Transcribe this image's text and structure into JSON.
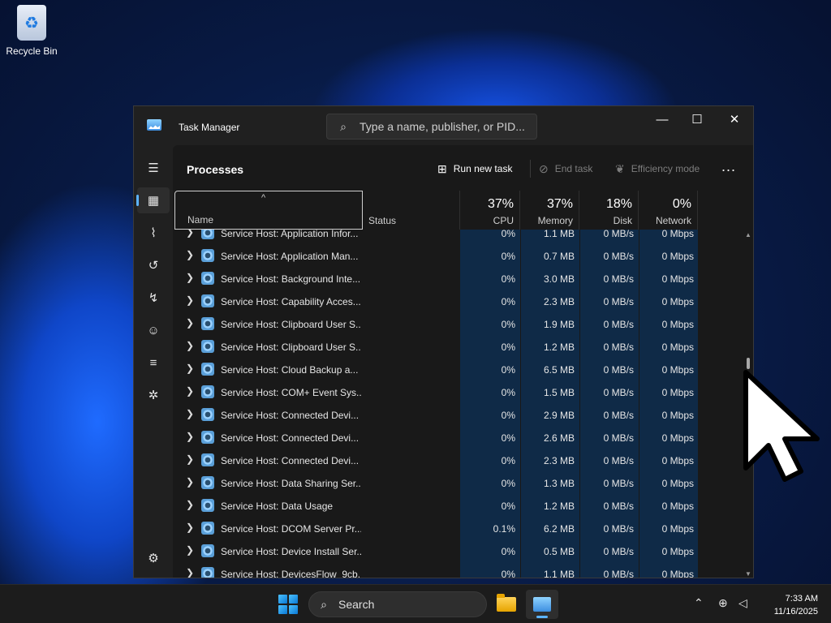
{
  "desktop": {
    "recycle_bin_label": "Recycle Bin"
  },
  "window": {
    "title": "Task Manager",
    "search_placeholder": "Type a name, publisher, or PID...",
    "controls": {
      "minimize": "—",
      "maximize": "☐",
      "close": "✕"
    }
  },
  "nav": {
    "items": [
      {
        "name": "hamburger-icon"
      },
      {
        "name": "processes-icon",
        "active": true
      },
      {
        "name": "performance-icon"
      },
      {
        "name": "app-history-icon"
      },
      {
        "name": "startup-apps-icon"
      },
      {
        "name": "users-icon"
      },
      {
        "name": "details-icon"
      },
      {
        "name": "services-icon"
      },
      {
        "name": "settings-icon"
      }
    ]
  },
  "toolbar": {
    "page_title": "Processes",
    "run_new_task": "Run new task",
    "end_task": "End task",
    "efficiency_mode": "Efficiency mode",
    "more": "..."
  },
  "table": {
    "columns": {
      "name": "Name",
      "status": "Status",
      "cpu": {
        "label": "CPU",
        "pct": "37%"
      },
      "memory": {
        "label": "Memory",
        "pct": "37%"
      },
      "disk": {
        "label": "Disk",
        "pct": "18%"
      },
      "network": {
        "label": "Network",
        "pct": "0%"
      }
    },
    "sort_caret": "^",
    "rows": [
      {
        "name": "Service Host: Application Infor...",
        "cpu": "0%",
        "memory": "1.1 MB",
        "disk": "0 MB/s",
        "network": "0 Mbps"
      },
      {
        "name": "Service Host: Application Man...",
        "cpu": "0%",
        "memory": "0.7 MB",
        "disk": "0 MB/s",
        "network": "0 Mbps"
      },
      {
        "name": "Service Host: Background Inte...",
        "cpu": "0%",
        "memory": "3.0 MB",
        "disk": "0 MB/s",
        "network": "0 Mbps"
      },
      {
        "name": "Service Host: Capability Acces...",
        "cpu": "0%",
        "memory": "2.3 MB",
        "disk": "0 MB/s",
        "network": "0 Mbps"
      },
      {
        "name": "Service Host: Clipboard User S...",
        "cpu": "0%",
        "memory": "1.9 MB",
        "disk": "0 MB/s",
        "network": "0 Mbps"
      },
      {
        "name": "Service Host: Clipboard User S...",
        "cpu": "0%",
        "memory": "1.2 MB",
        "disk": "0 MB/s",
        "network": "0 Mbps"
      },
      {
        "name": "Service Host: Cloud Backup a...",
        "cpu": "0%",
        "memory": "6.5 MB",
        "disk": "0 MB/s",
        "network": "0 Mbps"
      },
      {
        "name": "Service Host: COM+ Event Sys...",
        "cpu": "0%",
        "memory": "1.5 MB",
        "disk": "0 MB/s",
        "network": "0 Mbps"
      },
      {
        "name": "Service Host: Connected Devi...",
        "cpu": "0%",
        "memory": "2.9 MB",
        "disk": "0 MB/s",
        "network": "0 Mbps"
      },
      {
        "name": "Service Host: Connected Devi...",
        "cpu": "0%",
        "memory": "2.6 MB",
        "disk": "0 MB/s",
        "network": "0 Mbps"
      },
      {
        "name": "Service Host: Connected Devi...",
        "cpu": "0%",
        "memory": "2.3 MB",
        "disk": "0 MB/s",
        "network": "0 Mbps"
      },
      {
        "name": "Service Host: Data Sharing Ser...",
        "cpu": "0%",
        "memory": "1.3 MB",
        "disk": "0 MB/s",
        "network": "0 Mbps"
      },
      {
        "name": "Service Host: Data Usage",
        "cpu": "0%",
        "memory": "1.2 MB",
        "disk": "0 MB/s",
        "network": "0 Mbps"
      },
      {
        "name": "Service Host: DCOM Server Pr...",
        "cpu": "0.1%",
        "memory": "6.2 MB",
        "disk": "0 MB/s",
        "network": "0 Mbps"
      },
      {
        "name": "Service Host: Device Install Ser...",
        "cpu": "0%",
        "memory": "0.5 MB",
        "disk": "0 MB/s",
        "network": "0 Mbps"
      },
      {
        "name": "Service Host: DevicesFlow_9cb...",
        "cpu": "0%",
        "memory": "1.1 MB",
        "disk": "0 MB/s",
        "network": "0 Mbps"
      }
    ]
  },
  "taskbar": {
    "search_label": "Search",
    "time": "7:33 AM",
    "date": "11/16/2025"
  },
  "colors": {
    "window_bg": "#202020",
    "content_bg": "#191919",
    "resource_col_bg": "#0f2a47",
    "accent": "#5cb3ff"
  }
}
